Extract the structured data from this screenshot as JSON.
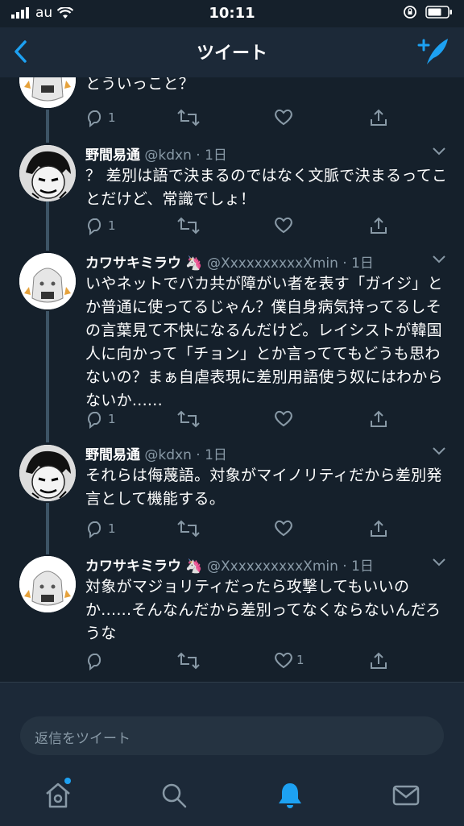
{
  "status": {
    "carrier": "au",
    "time": "10:11"
  },
  "nav": {
    "title": "ツイート"
  },
  "partial_tweet": {
    "text": "とういっこと？",
    "reply_count": "1"
  },
  "tweets": [
    {
      "name": "野間易通",
      "handle": "@kdxn",
      "time": "1日",
      "text": "？ 差別は語で決まるのではなく文脈で決まるってことだけど、常識でしょ！",
      "reply_count": "1",
      "like_count": ""
    },
    {
      "name": "カワサキミラウ",
      "emoji": "🦄",
      "handle": "@XxxxxxxxxxXmin",
      "time": "1日",
      "text": "いやネットでバカ共が障がい者を表す「ガイジ」とか普通に使ってるじゃん？僕自身病気持ってるしその言葉見て不快になるんだけど。レイシストが韓国人に向かって「チョン」とか言っててもどうも思わないの？まぁ自虐表現に差別用語使う奴にはわからないか......",
      "reply_count": "1",
      "like_count": ""
    },
    {
      "name": "野間易通",
      "handle": "@kdxn",
      "time": "1日",
      "text": "それらは侮蔑語。対象がマイノリティだから差別発言として機能する。",
      "reply_count": "1",
      "like_count": ""
    },
    {
      "name": "カワサキミラウ",
      "emoji": "🦄",
      "handle": "@XxxxxxxxxxXmin",
      "time": "1日",
      "text": "対象がマジョリティだったら攻撃してもいいのか......そんなんだから差別ってなくならないんだろうな",
      "reply_count": "",
      "like_count": "1"
    }
  ],
  "reply": {
    "placeholder": "返信をツイート"
  },
  "tabs": [
    "home-icon",
    "search-icon",
    "bell-icon",
    "mail-icon"
  ],
  "colors": {
    "background": "#15202b",
    "bar": "#1c2938",
    "accent": "#1da1f2",
    "muted": "#8899a6"
  }
}
